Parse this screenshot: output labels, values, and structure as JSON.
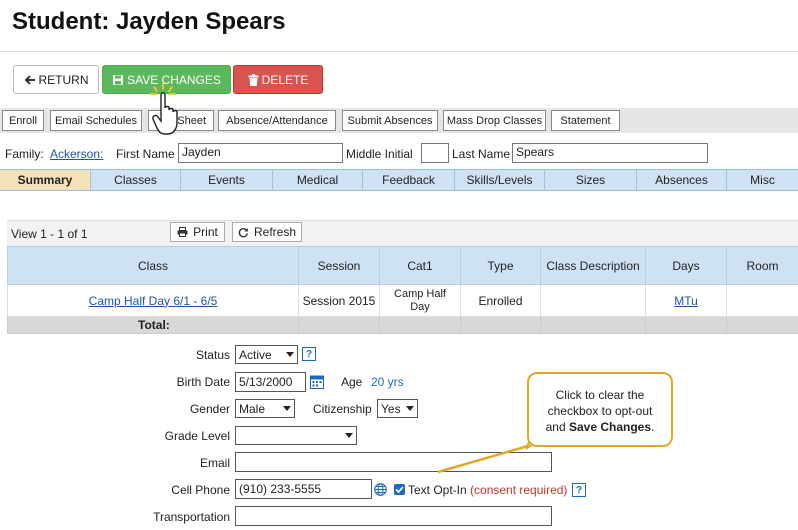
{
  "header": {
    "title": "Student: Jayden Spears"
  },
  "actions": {
    "return_label": "RETURN",
    "save_label": "SAVE CHANGES",
    "delete_label": "DELETE"
  },
  "toolbar": {
    "items": [
      "Enroll",
      "Email Schedules",
      "Sheet",
      "Absence/Attendance",
      "Submit Absences",
      "Mass Drop Classes",
      "Statement"
    ]
  },
  "family_row": {
    "family_label": "Family:",
    "family_link": "Ackerson:",
    "first_name_label": "First Name",
    "first_name_value": "Jayden",
    "middle_initial_label": "Middle Initial",
    "middle_initial_value": "",
    "last_name_label": "Last Name",
    "last_name_value": "Spears"
  },
  "tabs": [
    "Summary",
    "Classes",
    "Events",
    "Medical",
    "Feedback",
    "Skills/Levels",
    "Sizes",
    "Absences",
    "Misc"
  ],
  "active_tab": "Summary",
  "grid": {
    "count_text": "View 1 - 1 of 1",
    "print_label": "Print",
    "refresh_label": "Refresh",
    "columns": [
      "Class",
      "Session",
      "Cat1",
      "Type",
      "Class Description",
      "Days",
      "Room"
    ],
    "rows": [
      {
        "class": "Camp Half Day 6/1 - 6/5",
        "session": "Session 2015",
        "cat1": "Camp Half Day",
        "type": "Enrolled",
        "description": "",
        "days": "MTu",
        "room": ""
      }
    ],
    "total_label": "Total:"
  },
  "form": {
    "status_label": "Status",
    "status_value": "Active",
    "birth_date_label": "Birth Date",
    "birth_date_value": "5/13/2000",
    "age_label": "Age",
    "age_value": "20 yrs",
    "gender_label": "Gender",
    "gender_value": "Male",
    "citizenship_label": "Citizenship",
    "citizenship_value": "Yes",
    "grade_level_label": "Grade Level",
    "grade_level_value": "",
    "email_label": "Email",
    "email_value": "",
    "cell_phone_label": "Cell Phone",
    "cell_phone_value": "(910) 233-5555",
    "text_opt_in_label": "Text Opt-In",
    "text_opt_in_checked": true,
    "consent_text": "(consent required)",
    "transportation_label": "Transportation",
    "transportation_value": ""
  },
  "callout": {
    "line1": "Click to clear the",
    "line2": "checkbox to opt-out",
    "line3_prefix": "and ",
    "line3_bold": "Save Changes",
    "line3_suffix": "."
  },
  "colors": {
    "save_green": "#5cb85c",
    "delete_red": "#d9534f",
    "tab_blue": "#cfe2f3",
    "active_tab": "#f6e2b8",
    "callout_border": "#e4a629",
    "link_blue": "#1a55a8"
  }
}
